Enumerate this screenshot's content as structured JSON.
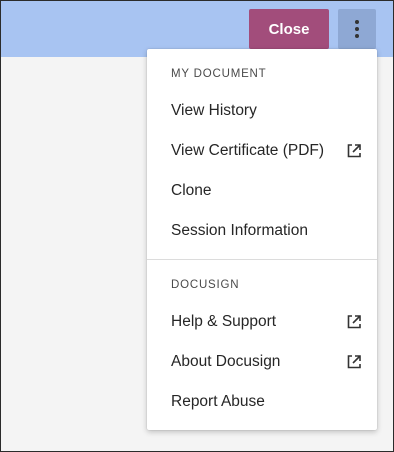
{
  "header": {
    "close_label": "Close",
    "more_options_icon": "vertical-ellipsis-icon"
  },
  "menu": {
    "sections": [
      {
        "title": "MY DOCUMENT",
        "items": [
          {
            "label": "View History",
            "external": false
          },
          {
            "label": "View Certificate (PDF)",
            "external": true
          },
          {
            "label": "Clone",
            "external": false
          },
          {
            "label": "Session Information",
            "external": false
          }
        ]
      },
      {
        "title": "DOCUSIGN",
        "items": [
          {
            "label": "Help & Support",
            "external": true
          },
          {
            "label": "About Docusign",
            "external": true
          },
          {
            "label": "Report Abuse",
            "external": false
          }
        ]
      }
    ],
    "external_link_icon": "external-link-icon"
  },
  "colors": {
    "topbar_bg": "#a8c4f2",
    "close_button_bg": "#a24d7b",
    "kebab_button_bg": "#8ea8d4",
    "page_bg": "#f4f4f4"
  }
}
